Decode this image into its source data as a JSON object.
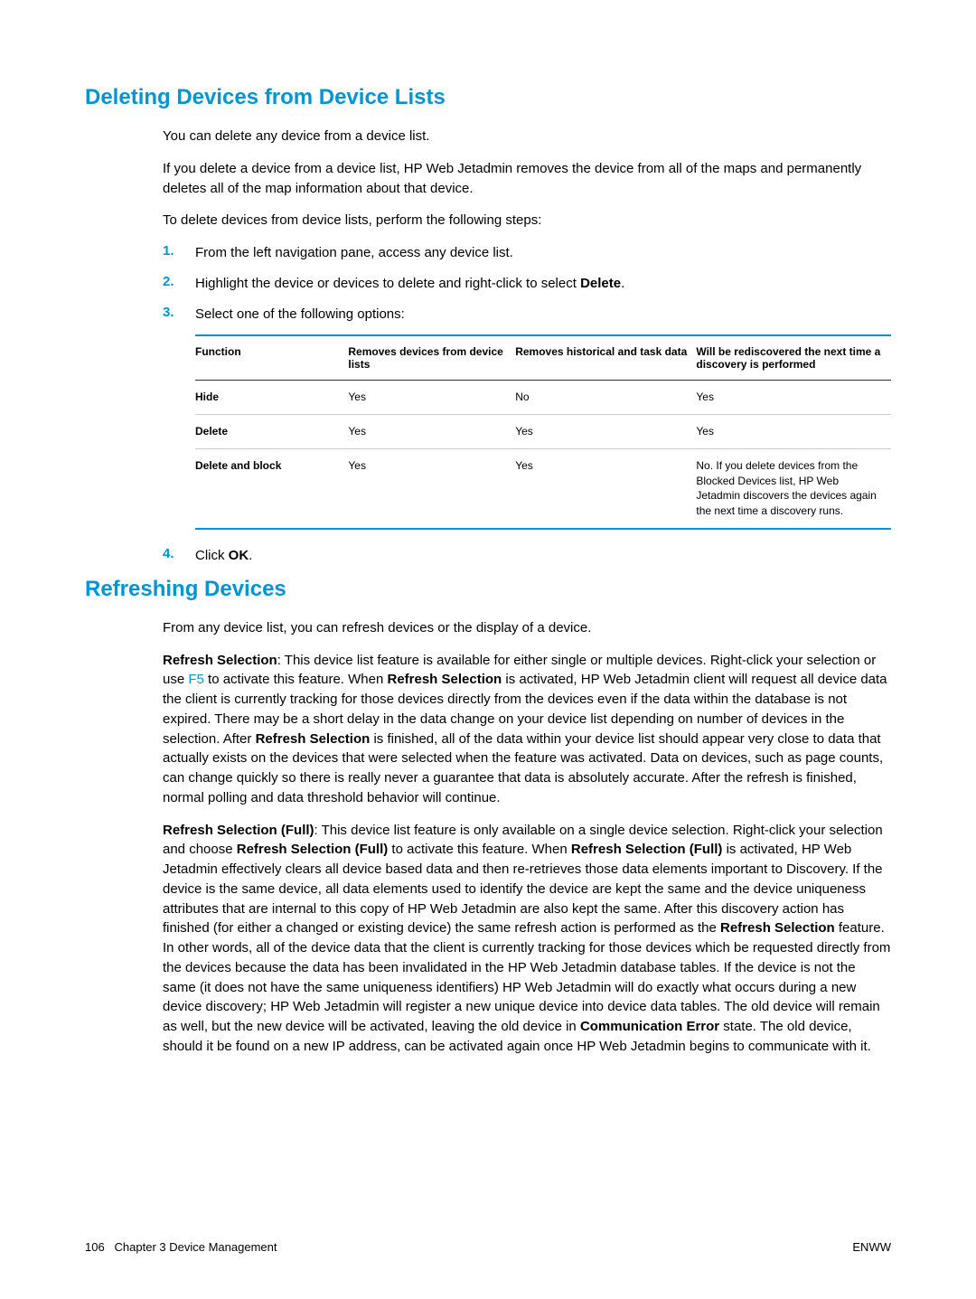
{
  "section1": {
    "heading": "Deleting Devices from Device Lists",
    "intro1": "You can delete any device from a device list.",
    "intro2": "If you delete a device from a device list, HP Web Jetadmin removes the device from all of the maps and permanently deletes all of the map information about that device.",
    "intro3": "To delete devices from device lists, perform the following steps:",
    "steps": {
      "s1_num": "1.",
      "s1_text": "From the left navigation pane, access any device list.",
      "s2_num": "2.",
      "s2_pre": "Highlight the device or devices to delete and right-click to select ",
      "s2_bold": "Delete",
      "s2_post": ".",
      "s3_num": "3.",
      "s3_text": "Select one of the following options:",
      "s4_num": "4.",
      "s4_pre": "Click ",
      "s4_bold": "OK",
      "s4_post": "."
    },
    "table": {
      "headers": {
        "h1": "Function",
        "h2": "Removes devices from device lists",
        "h3": "Removes historical and task data",
        "h4": "Will be rediscovered the next time a discovery is performed"
      },
      "rows": [
        {
          "c1": "Hide",
          "c2": "Yes",
          "c3": "No",
          "c4": "Yes"
        },
        {
          "c1": "Delete",
          "c2": "Yes",
          "c3": "Yes",
          "c4": "Yes"
        },
        {
          "c1": "Delete and block",
          "c2": "Yes",
          "c3": "Yes",
          "c4": "No. If you delete devices from the Blocked Devices list, HP Web Jetadmin discovers the devices again the next time a discovery runs."
        }
      ]
    }
  },
  "section2": {
    "heading": "Refreshing Devices",
    "p1": "From any device list, you can refresh devices or the display of a device.",
    "p2": {
      "b1": "Refresh Selection",
      "t1": ": This device list feature is available for either single or multiple devices. Right-click your selection or use ",
      "f5": "F5",
      "t2": " to activate this feature. When ",
      "b2": "Refresh Selection",
      "t3": " is activated, HP Web Jetadmin client will request all device data the client is currently tracking for those devices directly from the devices even if the data within the database is not expired. There may be a short delay in the data change on your device list depending on number of devices in the selection. After ",
      "b3": "Refresh Selection",
      "t4": " is finished, all of the data within your device list should appear very close to data that actually exists on the devices that were selected when the feature was activated. Data on devices, such as page counts, can change quickly so there is really never a guarantee that data is absolutely accurate. After the refresh is finished, normal polling and data threshold behavior will continue."
    },
    "p3": {
      "b1": "Refresh Selection (Full)",
      "t1": ": This device list feature is only available on a single device selection. Right-click your selection and choose ",
      "b2": "Refresh Selection (Full)",
      "t2": " to activate this feature. When ",
      "b3": "Refresh Selection (Full)",
      "t3": " is activated, HP Web Jetadmin effectively clears all device based data and then re-retrieves those data elements important to Discovery. If the device is the same device, all data elements used to identify the device are kept the same and the device uniqueness attributes that are internal to this copy of HP Web Jetadmin are also kept the same. After this discovery action has finished (for either a changed or existing device) the same refresh action is performed as the ",
      "b4": "Refresh Selection",
      "t4": " feature. In other words, all of the device data that the client is currently tracking for those devices which be requested directly from the devices because the data has been invalidated in the HP Web Jetadmin database tables. If the device is not the same (it does not have the same uniqueness identifiers) HP Web Jetadmin will do exactly what occurs during a new device discovery; HP Web Jetadmin will register a new unique device into device data tables. The old device will remain as well, but the new device will be activated, leaving the old device in ",
      "b5": "Communication Error",
      "t5": " state. The old device, should it be found on a new IP address, can be activated again once HP Web Jetadmin begins to communicate with it."
    }
  },
  "footer": {
    "page": "106",
    "chapter": "Chapter 3   Device Management",
    "right": "ENWW"
  }
}
